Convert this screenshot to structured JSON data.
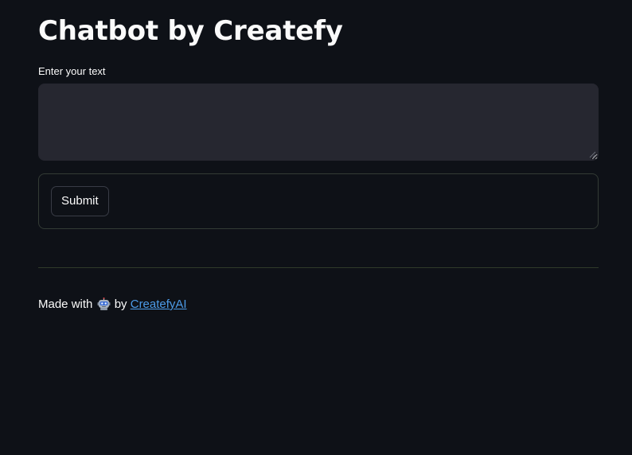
{
  "header": {
    "title": "Chatbot by Createfy"
  },
  "form": {
    "input_label": "Enter your text",
    "input_value": "",
    "submit_label": "Submit"
  },
  "footer": {
    "prefix": "Made with",
    "icon": "robot-icon",
    "by": "by",
    "link_text": "CreatefyAI"
  },
  "colors": {
    "background": "#0e1117",
    "input_background": "#262730",
    "text": "#fafafa",
    "link": "#4c9be8"
  }
}
